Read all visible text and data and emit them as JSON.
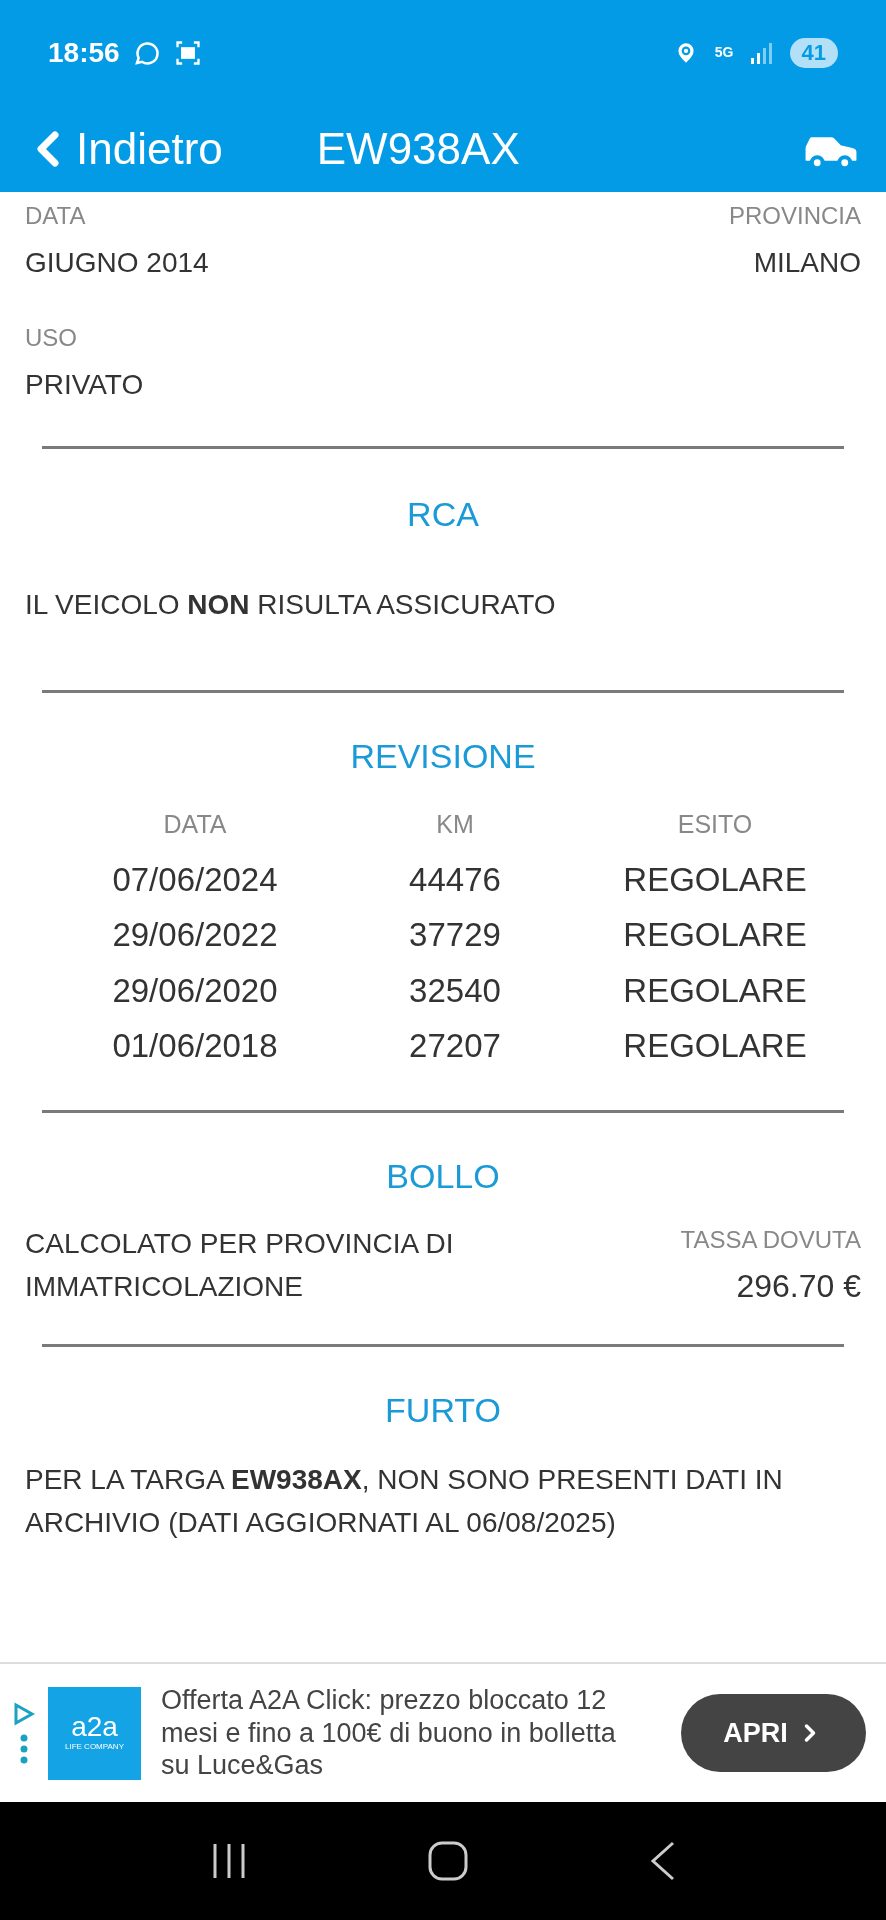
{
  "status_bar": {
    "time": "18:56",
    "network": "5G",
    "battery": "41"
  },
  "nav": {
    "back": "Indietro",
    "title": "EW938AX"
  },
  "info": {
    "left": {
      "label": "DATA",
      "value": "GIUGNO 2014"
    },
    "right": {
      "label": "PROVINCIA",
      "value": "MILANO"
    },
    "below": {
      "label": "USO",
      "value": "PRIVATO"
    }
  },
  "rca": {
    "title": "RCA",
    "text": "IL VEICOLO **NON** RISULTA ASSICURATO"
  },
  "revisione": {
    "title": "REVISIONE",
    "columns": [
      "DATA",
      "KM",
      "ESITO"
    ],
    "rows": [
      [
        "07/06/2024",
        "44476",
        "REGOLARE"
      ],
      [
        "29/06/2022",
        "37729",
        "REGOLARE"
      ],
      [
        "29/06/2020",
        "32540",
        "REGOLARE"
      ],
      [
        "01/06/2018",
        "27207",
        "REGOLARE"
      ]
    ]
  },
  "bollo": {
    "title": "BOLLO",
    "text": "CALCOLATO PER PROVINCIA DI IMMATRICOLAZIONE",
    "tax_label": "TASSA DOVUTA",
    "tax_value": "296.70 €"
  },
  "furto": {
    "title": "FURTO",
    "text": "PER LA TARGA **EW938AX**, NON SONO PRESENTI DATI IN ARCHIVIO (DATI AGGIORNATI AL 06/08/2025)"
  },
  "ad": {
    "logo": "a2a",
    "logo_sub": "LIFE COMPANY",
    "text": "Offerta A2A Click: prezzo bloccato 12 mesi e fino a 100€ di buono in bolletta su Luce&Gas",
    "button": "APRI"
  }
}
